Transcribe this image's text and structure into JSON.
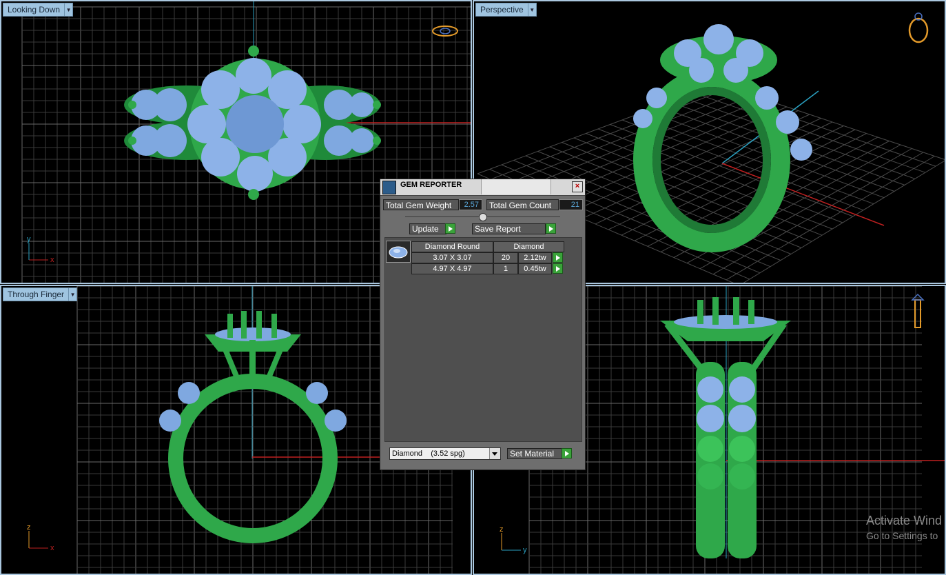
{
  "viewports": {
    "top_left": {
      "label": "Looking Down",
      "axis_h": "x",
      "axis_v": "y"
    },
    "top_right": {
      "label": "Perspective"
    },
    "bottom_left": {
      "label": "Through Finger",
      "axis_h": "x",
      "axis_v": "z"
    },
    "bottom_right": {
      "axis_h": "y",
      "axis_v": "z"
    }
  },
  "dialog": {
    "title": "GEM REPORTER",
    "total_weight_label": "Total Gem Weight",
    "total_weight_value": "2.57",
    "total_count_label": "Total Gem Count",
    "total_count_value": "21",
    "update_label": "Update",
    "save_report_label": "Save Report",
    "table_header": [
      "Diamond Round",
      "Diamond"
    ],
    "rows": [
      {
        "size": "3.07 X 3.07",
        "count": "20",
        "weight": "2.12tw"
      },
      {
        "size": "4.97 X 4.97",
        "count": "1",
        "weight": "0.45tw"
      }
    ],
    "material_value": "Diamond    (3.52 spg)",
    "set_material_label": "Set Material"
  },
  "watermark": {
    "line1": "Activate Wind",
    "line2": "Go to Settings to"
  },
  "colors": {
    "metal": "#2fa84a",
    "gem": "#7fa8e0",
    "viewport_border": "#9fc4e0",
    "grid": "#444444"
  }
}
